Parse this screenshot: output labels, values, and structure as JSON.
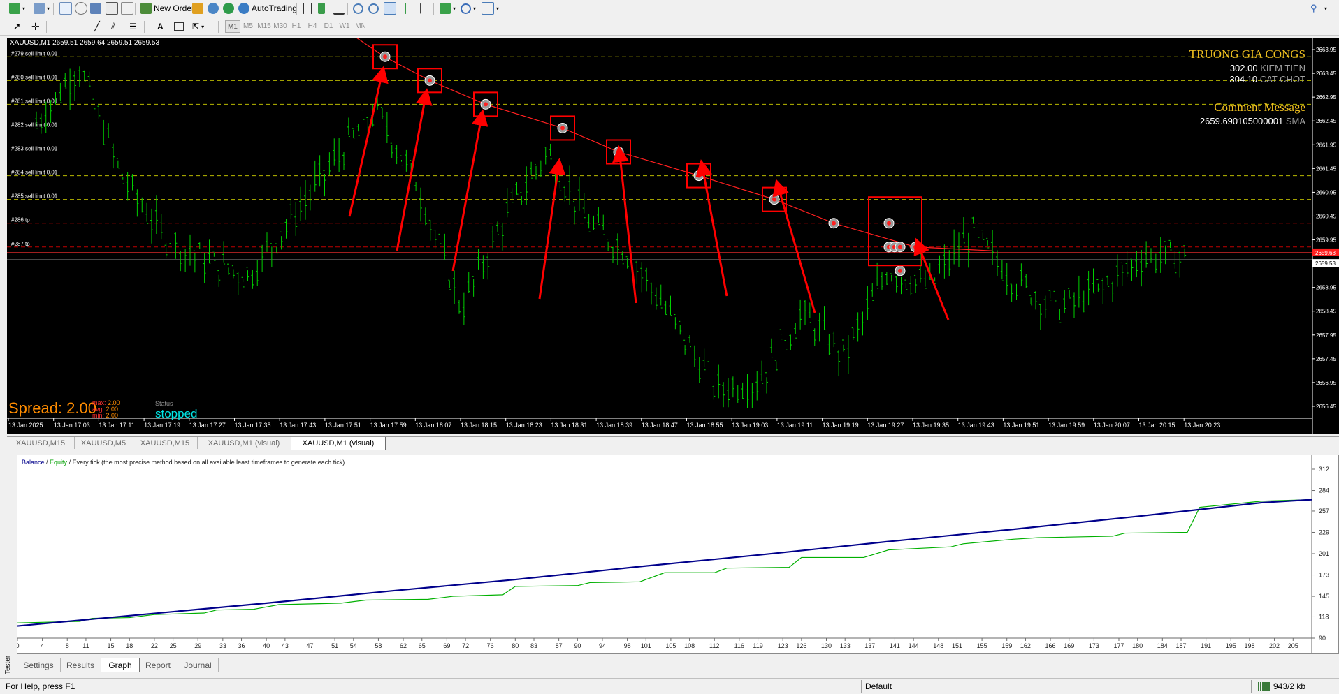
{
  "toolbar": {
    "new_order_label": "New Order",
    "autotrading_label": "AutoTrading",
    "timeframes": [
      "M1",
      "M5",
      "M15",
      "M30",
      "H1",
      "H4",
      "D1",
      "W1",
      "MN"
    ],
    "active_timeframe": "M1",
    "icons": [
      "new-chart-icon",
      "profiles-icon",
      "market-watch-icon",
      "navigator-icon",
      "data-window-icon",
      "terminal-icon",
      "tester-icon",
      "new-order-icon",
      "metaeditor-icon",
      "signals-icon",
      "market-icon",
      "autotrading-icon",
      "bar-chart-icon",
      "candles-icon",
      "line-chart-icon",
      "zoom-in-icon",
      "zoom-out-icon",
      "tile-icon",
      "autoscroll-icon",
      "chart-shift-icon",
      "indicators-icon",
      "periods-icon",
      "templates-icon",
      "search-icon",
      "cursor-icon",
      "crosshair-icon",
      "vertical-line-icon",
      "horizontal-line-icon",
      "trendline-icon",
      "channel-icon",
      "fibonacci-icon",
      "text-icon",
      "label-icon",
      "arrows-icon"
    ]
  },
  "chart": {
    "header": "XAUUSD,M1  2659.51 2659.64 2659.51 2659.53",
    "brand_title": "TRUONG GIA CONGS",
    "stats": [
      {
        "value": "302.00",
        "label": "KIEM TIEN"
      },
      {
        "value": "304.10",
        "label": "CAT CHOT"
      }
    ],
    "comment_title": "Comment Message",
    "comment_value": "2659.690105000001",
    "comment_value_label": "SMA",
    "spread_label": "Spread: 2.00",
    "spread_stats": [
      {
        "label": "max:",
        "value": "2.00"
      },
      {
        "label": "avg:",
        "value": "2.00"
      },
      {
        "label": "min:",
        "value": "2.00"
      }
    ],
    "status_label": "Status",
    "status_value": "stopped",
    "orders": [
      {
        "price": 2663.8,
        "label": "#279 sell limit 0.01",
        "color": "#b8b800"
      },
      {
        "price": 2663.3,
        "label": "#280 sell limit 0.01",
        "color": "#b8b800"
      },
      {
        "price": 2662.8,
        "label": "#281 sell limit 0.01",
        "color": "#b8b800"
      },
      {
        "price": 2662.3,
        "label": "#282 sell limit 0.01",
        "color": "#b8b800"
      },
      {
        "price": 2661.8,
        "label": "#283 sell limit 0.01",
        "color": "#b8b800"
      },
      {
        "price": 2661.3,
        "label": "#284 sell limit 0.01",
        "color": "#b8b800"
      },
      {
        "price": 2660.8,
        "label": "#285 sell limit 0.01",
        "color": "#b8b800"
      },
      {
        "price": 2660.3,
        "label": "#286 tp",
        "color": "#c00000"
      },
      {
        "price": 2659.8,
        "label": "#287 tp",
        "color": "#c00000"
      }
    ],
    "price_ticks": [
      "2663.95",
      "2663.45",
      "2662.95",
      "2662.45",
      "2661.95",
      "2661.45",
      "2660.95",
      "2660.45",
      "2659.95",
      "2659.45",
      "2658.95",
      "2658.45",
      "2657.95",
      "2657.45",
      "2656.95",
      "2656.45"
    ],
    "current_price_tag": "2659.53",
    "red_price_tag": "2659.68",
    "time_ticks": [
      "13 Jan 2025",
      "13 Jan 17:03",
      "13 Jan 17:11",
      "13 Jan 17:19",
      "13 Jan 17:27",
      "13 Jan 17:35",
      "13 Jan 17:43",
      "13 Jan 17:51",
      "13 Jan 17:59",
      "13 Jan 18:07",
      "13 Jan 18:15",
      "13 Jan 18:23",
      "13 Jan 18:31",
      "13 Jan 18:39",
      "13 Jan 18:47",
      "13 Jan 18:55",
      "13 Jan 19:03",
      "13 Jan 19:11",
      "13 Jan 19:19",
      "13 Jan 19:27",
      "13 Jan 19:35",
      "13 Jan 19:43",
      "13 Jan 19:51",
      "13 Jan 19:59",
      "13 Jan 20:07",
      "13 Jan 20:15",
      "13 Jan 20:23"
    ],
    "colors": {
      "background": "#000000",
      "candles": "#00e000",
      "sma": "#ff2020",
      "brand": "#f0c020",
      "spread": "#ff8c00",
      "status": "#00e6e6"
    }
  },
  "chart_tabs": [
    "XAUUSD,M15",
    "XAUUSD,M5",
    "XAUUSD,M15",
    "XAUUSD,M1 (visual)",
    "XAUUSD,M1 (visual)"
  ],
  "active_chart_tab": 4,
  "graph": {
    "legend_balance": "Balance",
    "legend_sep": " / ",
    "legend_equity": "Equity",
    "legend_rest": " / Every tick (the most precise method based on all available least timeframes to generate each tick)",
    "chart_data": {
      "type": "line",
      "x_ticks": [
        "0",
        "4",
        "8",
        "11",
        "15",
        "18",
        "22",
        "25",
        "29",
        "33",
        "36",
        "40",
        "43",
        "47",
        "51",
        "54",
        "58",
        "62",
        "65",
        "69",
        "72",
        "76",
        "80",
        "83",
        "87",
        "90",
        "94",
        "98",
        "101",
        "105",
        "108",
        "112",
        "116",
        "119",
        "123",
        "126",
        "130",
        "133",
        "137",
        "141",
        "144",
        "148",
        "151",
        "155",
        "159",
        "162",
        "166",
        "169",
        "173",
        "177",
        "180",
        "184",
        "187",
        "191",
        "195",
        "198",
        "202",
        "205"
      ],
      "y_ticks": [
        "312",
        "284",
        "257",
        "229",
        "201",
        "173",
        "145",
        "118",
        "90"
      ],
      "ylim": [
        90,
        312
      ],
      "xlim": [
        0,
        208
      ],
      "series": [
        {
          "name": "Balance",
          "color": "#00008b",
          "x": [
            0,
            20,
            40,
            60,
            80,
            100,
            120,
            140,
            160,
            180,
            200,
            208
          ],
          "y": [
            106,
            121,
            136,
            152,
            167,
            184,
            200,
            217,
            233,
            250,
            268,
            272
          ]
        },
        {
          "name": "Equity",
          "color": "#00b000",
          "x": [
            0,
            10,
            12,
            18,
            22,
            30,
            32,
            38,
            42,
            52,
            56,
            66,
            70,
            78,
            80,
            90,
            92,
            100,
            104,
            112,
            114,
            124,
            126,
            136,
            140,
            150,
            152,
            160,
            164,
            176,
            178,
            188,
            190,
            200,
            208
          ],
          "y": [
            110,
            112,
            116,
            117,
            121,
            123,
            127,
            128,
            134,
            136,
            140,
            141,
            145,
            147,
            158,
            159,
            163,
            164,
            176,
            176,
            182,
            183,
            196,
            196,
            206,
            210,
            214,
            220,
            222,
            224,
            228,
            229,
            262,
            270,
            272
          ]
        }
      ]
    }
  },
  "tester_label": "Tester",
  "tester_tabs": [
    "Settings",
    "Results",
    "Graph",
    "Report",
    "Journal"
  ],
  "active_tester_tab": 2,
  "status": {
    "help": "For Help, press F1",
    "profile": "Default",
    "traffic": "943/2 kb"
  }
}
